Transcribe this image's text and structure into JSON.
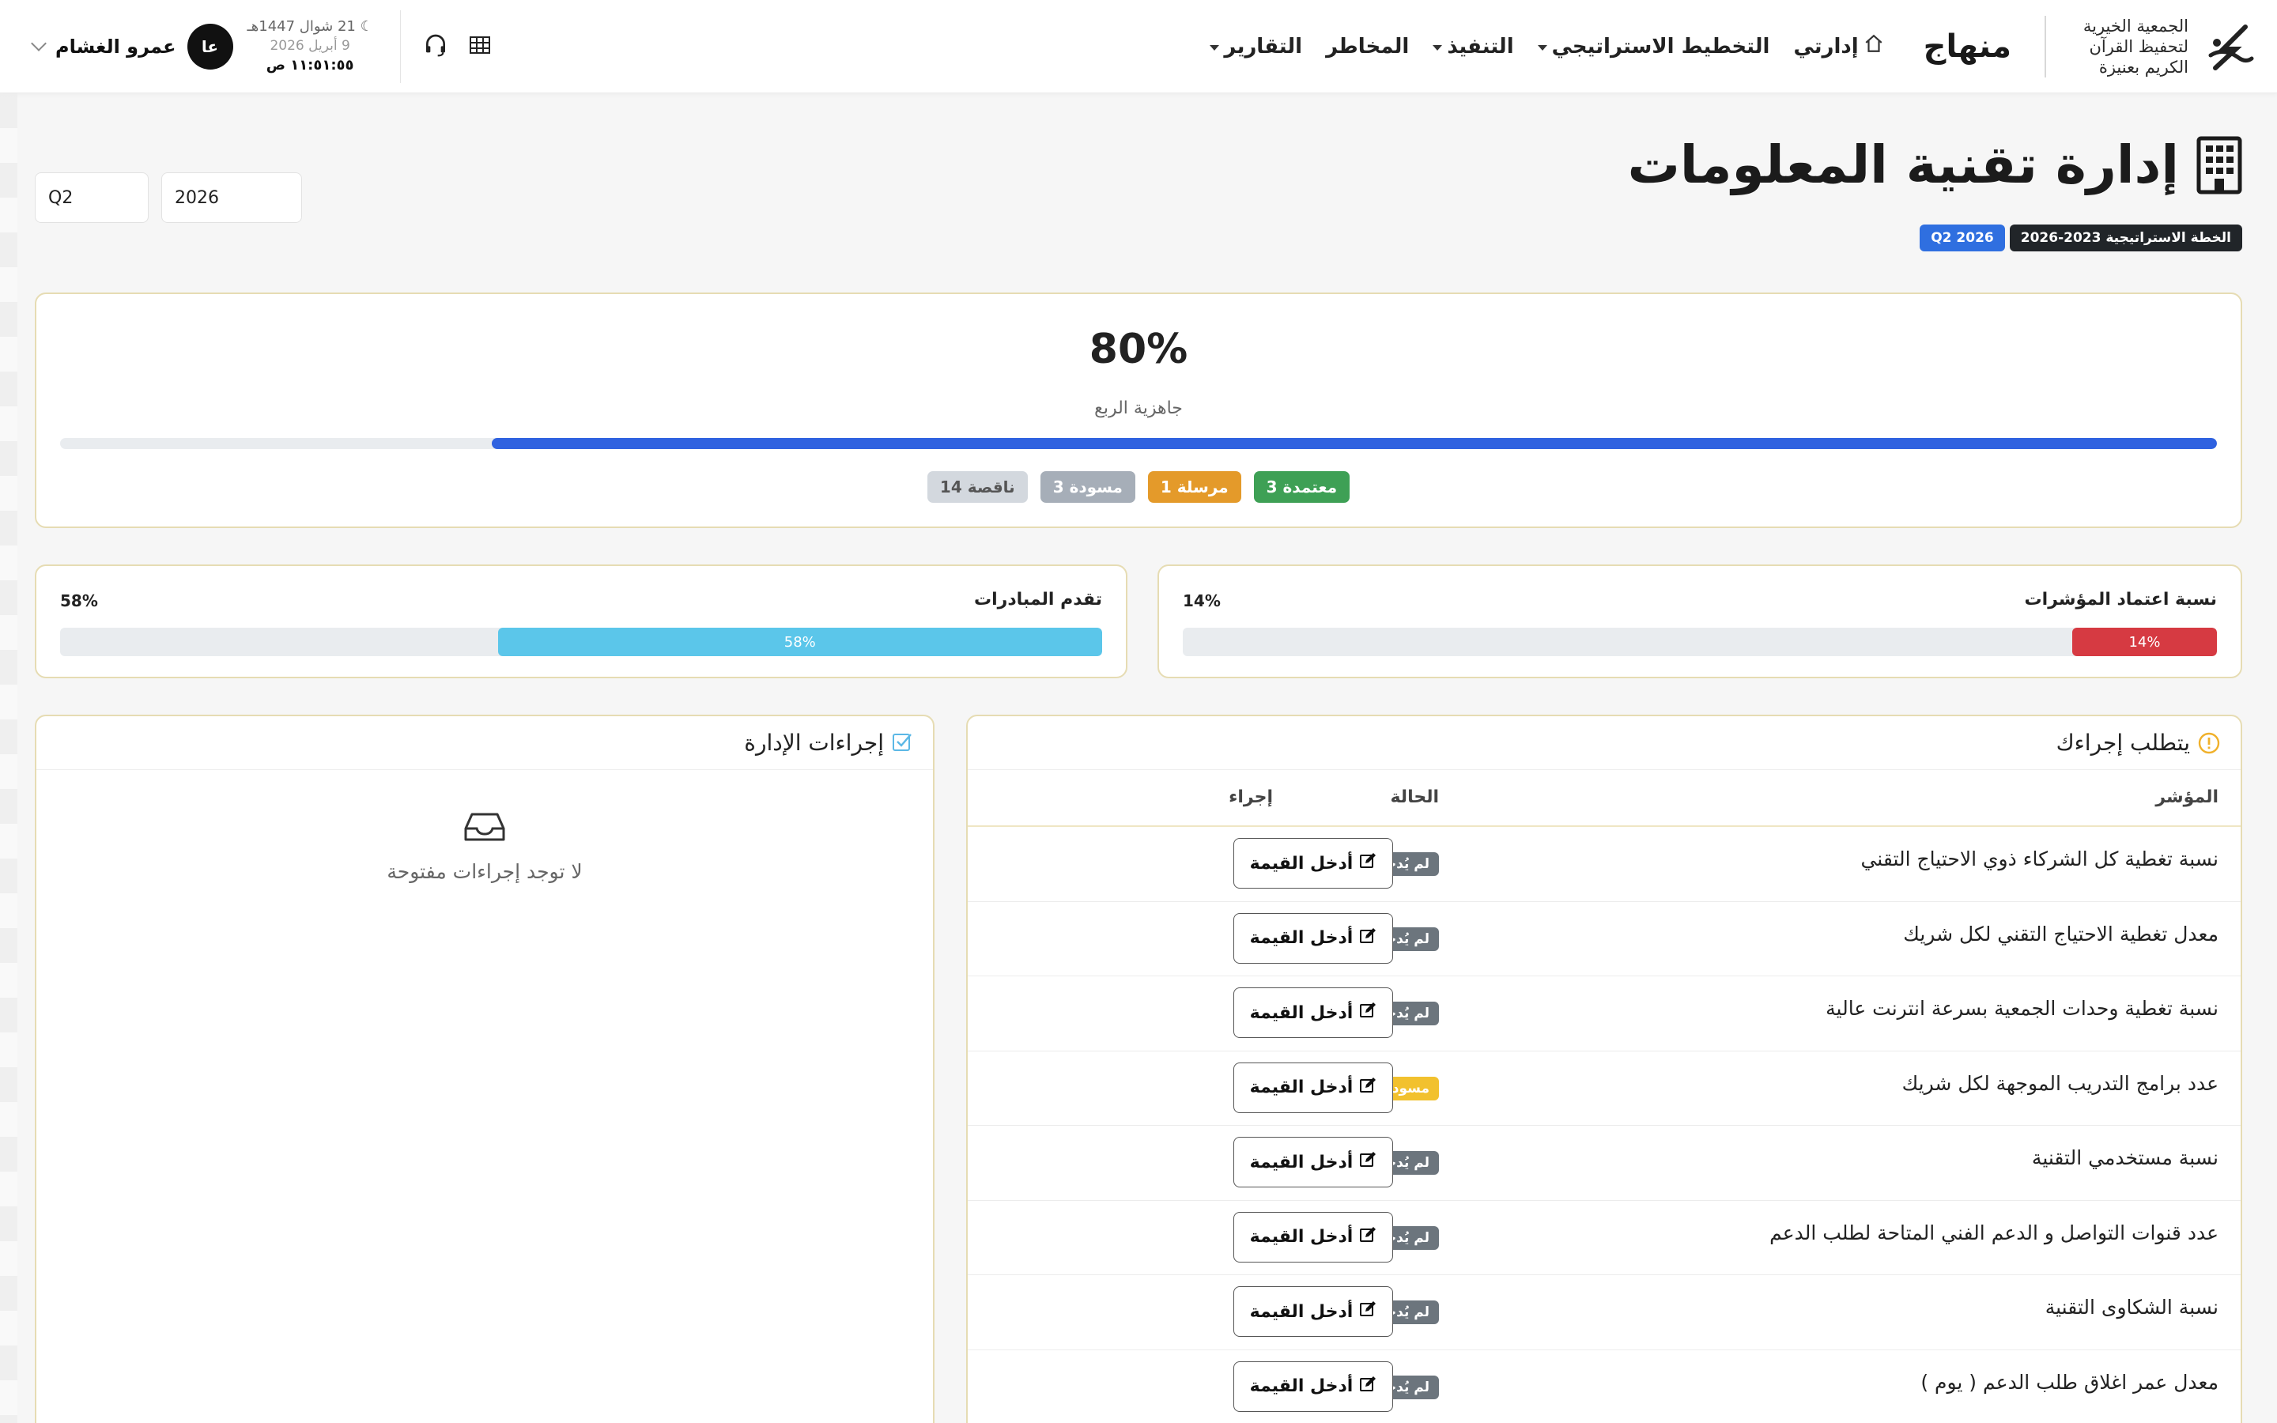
{
  "brand": {
    "org": "الجمعية الخيرية لتحفيظ القرآن الكريم بعنيزة",
    "name": "منهاج"
  },
  "nav": {
    "items": [
      {
        "label": "إدارتي",
        "icon": "home-icon",
        "dropdown": false
      },
      {
        "label": "التخطيط الاستراتيجي",
        "dropdown": true
      },
      {
        "label": "التنفيذ",
        "dropdown": true
      },
      {
        "label": "المخاطر",
        "dropdown": false
      },
      {
        "label": "التقارير",
        "dropdown": true
      }
    ]
  },
  "datetime": {
    "hijri": "21 شوال 1447هـ",
    "gregorian": "9 أبريل 2026",
    "time": "١١:٥١:٥٥ ص"
  },
  "user": {
    "initials": "عا",
    "name": "عمرو الغشام"
  },
  "page": {
    "title": "إدارة تقنية المعلومات",
    "tags": [
      "الخطة الاستراتيجية 2023-2026",
      "Q2 2026"
    ]
  },
  "filters": {
    "year": "2026",
    "quarter": "Q2"
  },
  "readiness": {
    "percent_label": "80%",
    "label": "جاهزية الربع",
    "progress": 0.8,
    "badges": [
      {
        "label": "معتمدة 3",
        "kind": "green"
      },
      {
        "label": "مرسلة 1",
        "kind": "orange"
      },
      {
        "label": "مسودة 3",
        "kind": "gray"
      },
      {
        "label": "ناقصة 14",
        "kind": "light"
      }
    ]
  },
  "kpis": {
    "approval": {
      "title": "نسبة اعتماد المؤشرات",
      "value_label": "14%",
      "bar_label": "14%",
      "progress": 0.14,
      "color": "#d63a42"
    },
    "initiatives": {
      "title": "تقدم المبادرات",
      "value_label": "58%",
      "bar_label": "58%",
      "progress": 0.58,
      "color": "#5bc6ea"
    }
  },
  "action_required": {
    "title": "يتطلب إجراءك",
    "headers": {
      "indicator": "المؤشر",
      "status": "الحالة",
      "action": "إجراء"
    },
    "button_label": "أدخل القيمة",
    "rows": [
      {
        "name": "نسبة تغطية كل الشركاء ذوي الاحتياج التقني",
        "status": "لم يُدخل",
        "kind": "na"
      },
      {
        "name": "معدل تغطية الاحتياج التقني لكل شريك",
        "status": "لم يُدخل",
        "kind": "na"
      },
      {
        "name": "نسبة تغطية وحدات الجمعية بسرعة انترنت عالية",
        "status": "لم يُدخل",
        "kind": "na"
      },
      {
        "name": "عدد برامج التدريب الموجهة لكل شريك",
        "status": "مسودة",
        "kind": "draft"
      },
      {
        "name": "نسبة مستخدمي التقنية",
        "status": "لم يُدخل",
        "kind": "na"
      },
      {
        "name": "عدد قنوات التواصل و الدعم الفني المتاحة لطلب الدعم",
        "status": "لم يُدخل",
        "kind": "na"
      },
      {
        "name": "نسبة الشكاوى التقنية",
        "status": "لم يُدخل",
        "kind": "na"
      },
      {
        "name": "معدل عمر اغلاق طلب الدعم ( يوم )",
        "status": "لم يُدخل",
        "kind": "na"
      }
    ]
  },
  "admin_actions": {
    "title": "إجراءات الإدارة",
    "empty_message": "لا توجد إجراءات مفتوحة"
  }
}
